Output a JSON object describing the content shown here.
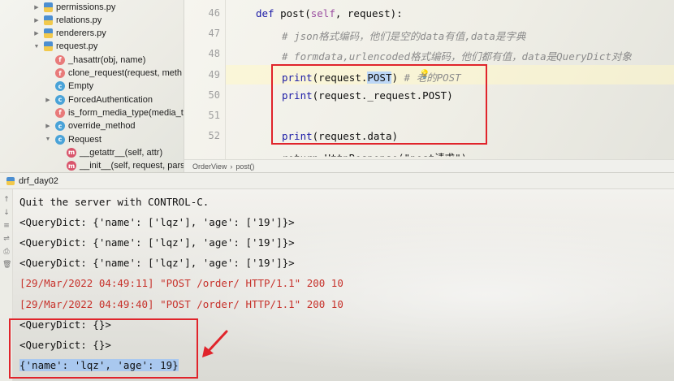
{
  "project_tree": {
    "items": [
      {
        "kind": "file",
        "label": "permissions.py",
        "arrow": "▶"
      },
      {
        "kind": "file",
        "label": "relations.py",
        "arrow": "▶"
      },
      {
        "kind": "file",
        "label": "renderers.py",
        "arrow": "▶"
      },
      {
        "kind": "file",
        "label": "request.py",
        "arrow": "▼"
      },
      {
        "kind": "f",
        "label": "_hasattr(obj, name)"
      },
      {
        "kind": "f",
        "label": "clone_request(request, meth"
      },
      {
        "kind": "c",
        "label": "Empty"
      },
      {
        "kind": "c",
        "label": "ForcedAuthentication",
        "arrow": "▶"
      },
      {
        "kind": "f",
        "label": "is_form_media_type(media_t"
      },
      {
        "kind": "c",
        "label": "override_method",
        "arrow": "▶"
      },
      {
        "kind": "c",
        "label": "Request",
        "arrow": "▼"
      },
      {
        "kind": "m",
        "label": "__getattr__(self, attr)"
      },
      {
        "kind": "m",
        "label": "__init__(self, request, pars"
      }
    ]
  },
  "editor": {
    "line_numbers": [
      "46",
      "47",
      "48",
      "49",
      "50",
      "51",
      "52"
    ],
    "lines": {
      "l46_def": "def ",
      "l46_name": "post(",
      "l46_self": "self",
      "l46_rest": ", request):",
      "l47": "# json格式编码，他们是空的data有值,data是字典",
      "l48": "# formdata,urlencoded格式编码，他们都有值，data是QueryDict对象",
      "l49_print": "print",
      "l49_a": "(request.",
      "l49_sel": "POST",
      "l49_b": ") ",
      "l49_cm": "# 老的POST",
      "l50_print": "print",
      "l50_rest": "(request._request.POST)",
      "l52_print": "print",
      "l52_rest": "(request.data)",
      "l53": "return HttpResponse(\"post请求\")"
    },
    "breadcrumb": [
      "OrderView",
      "›",
      "post()"
    ]
  },
  "run_window": {
    "tab_label": "drf_day02",
    "tool_icons": [
      "↑",
      "↓",
      "≡",
      "⇌",
      "⎙",
      "🗑"
    ],
    "output": [
      {
        "text": "Quit the server with CONTROL-C.",
        "err": false
      },
      {
        "text": "<QueryDict: {'name': ['lqz'], 'age': ['19']}>",
        "err": false
      },
      {
        "text": "<QueryDict: {'name': ['lqz'], 'age': ['19']}>",
        "err": false
      },
      {
        "text": "<QueryDict: {'name': ['lqz'], 'age': ['19']}>",
        "err": false
      },
      {
        "text": "[29/Mar/2022 04:49:11] \"POST /order/ HTTP/1.1\" 200 10",
        "err": true
      },
      {
        "text": "[29/Mar/2022 04:49:40] \"POST /order/ HTTP/1.1\" 200 10",
        "err": true
      },
      {
        "text": "<QueryDict: {}>",
        "err": false
      },
      {
        "text": "<QueryDict: {}>",
        "err": false
      },
      {
        "text": "{'name': 'lqz', 'age': 19}",
        "err": false,
        "selected": true
      }
    ]
  },
  "colors": {
    "annotation_red": "#e0242b",
    "keyword_blue": "#1a1aa6",
    "error_red": "#c7322b",
    "selection_blue": "#a9c8ef"
  }
}
